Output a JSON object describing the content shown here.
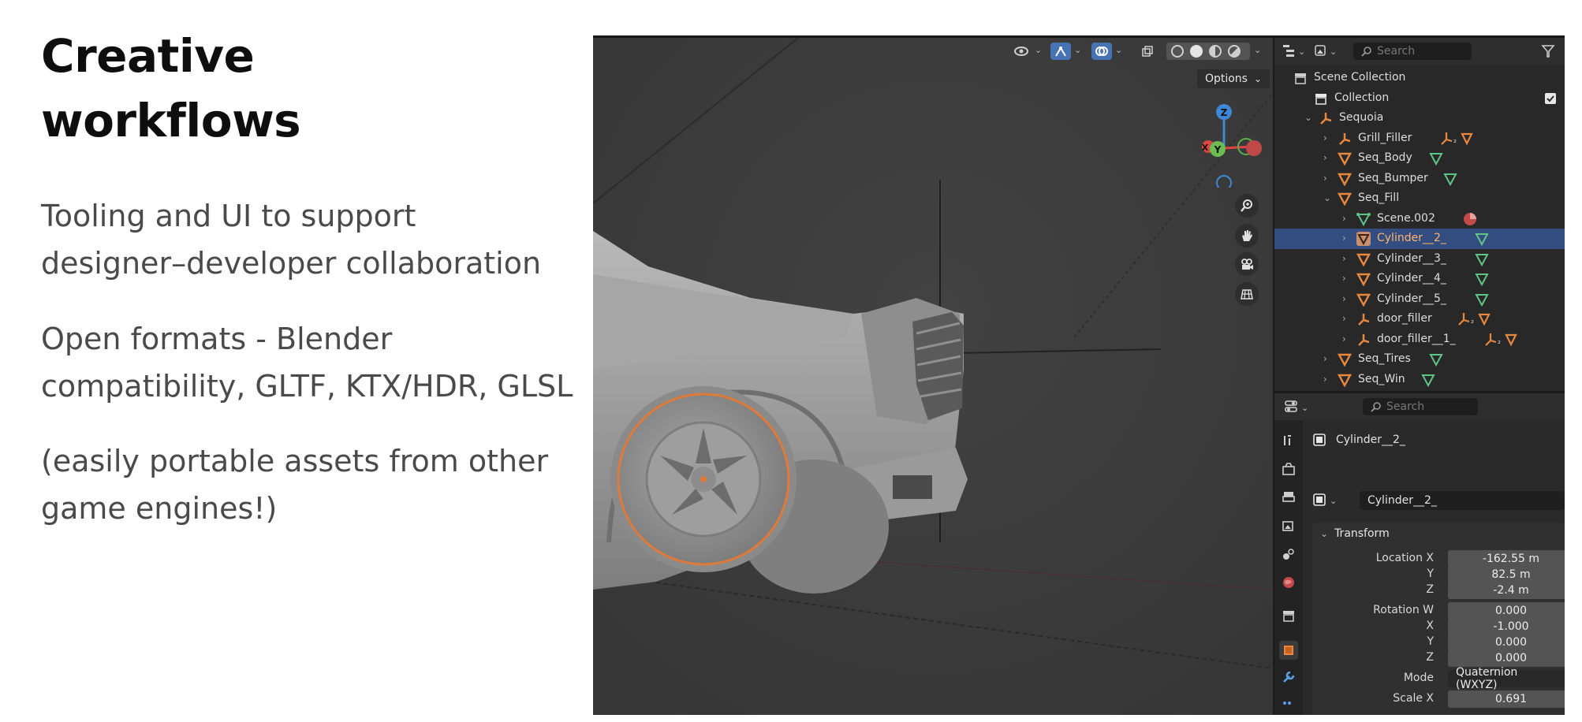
{
  "slide": {
    "title_line1": "Creative",
    "title_line2": "workflows",
    "bullets": [
      {
        "line1": "Tooling and UI to support",
        "line2": "designer–developer collaboration"
      },
      {
        "line1": "Open formats - Blender",
        "line2": "compatibility, GLTF, KTX/HDR, GLSL"
      },
      {
        "line1": "(easily portable assets from other",
        "line2": "game engines!)"
      }
    ]
  },
  "viewport": {
    "options_label": "Options",
    "gizmo_axes": {
      "z": "Z",
      "y": "Y",
      "x": "X"
    },
    "tools": [
      "zoom-icon",
      "hand-icon",
      "camera-icon",
      "grid-icon"
    ],
    "selection_outline_color": "#e07a3a",
    "active_button_color": "#4772b3"
  },
  "outliner": {
    "search_placeholder": "Search",
    "rows": [
      {
        "label": "Scene Collection",
        "icon": "scene-collection-icon"
      },
      {
        "label": "Collection",
        "icon": "collection-icon"
      },
      {
        "label": "Sequoia",
        "icon": "empty-icon"
      },
      {
        "label": "Grill_Filler",
        "icon": "empty-icon",
        "extra": "₂"
      },
      {
        "label": "Seq_Body",
        "icon": "mesh-icon"
      },
      {
        "label": "Seq_Bumper",
        "icon": "mesh-icon"
      },
      {
        "label": "Seq_Fill",
        "icon": "mesh-icon"
      },
      {
        "label": "Scene.002",
        "icon": "mesh-data-icon"
      },
      {
        "label": "Cylinder__2_",
        "icon": "mesh-icon"
      },
      {
        "label": "Cylinder__3_",
        "icon": "mesh-icon"
      },
      {
        "label": "Cylinder__4_",
        "icon": "mesh-icon"
      },
      {
        "label": "Cylinder__5_",
        "icon": "mesh-icon"
      },
      {
        "label": "door_filler",
        "icon": "empty-icon",
        "extra": "₂"
      },
      {
        "label": "door_filler__1_",
        "icon": "empty-icon",
        "extra": "₂"
      },
      {
        "label": "Seq_Tires",
        "icon": "mesh-icon"
      },
      {
        "label": "Seq_Win",
        "icon": "mesh-icon"
      }
    ]
  },
  "properties": {
    "search_placeholder": "Search",
    "object_name": "Cylinder__2_",
    "datablock_name": "Cylinder__2_",
    "panel_title": "Transform",
    "fields": [
      {
        "label": "Location X",
        "value": "-162.55 m"
      },
      {
        "label": "Y",
        "value": "82.5 m"
      },
      {
        "label": "Z",
        "value": "-2.4 m"
      },
      {
        "label": "Rotation W",
        "value": "0.000"
      },
      {
        "label": "X",
        "value": "-1.000"
      },
      {
        "label": "Y",
        "value": "0.000"
      },
      {
        "label": "Z",
        "value": "0.000"
      },
      {
        "label": "Mode",
        "value": "Quaternion (WXYZ)"
      },
      {
        "label": "Scale X",
        "value": "0.691"
      }
    ]
  }
}
